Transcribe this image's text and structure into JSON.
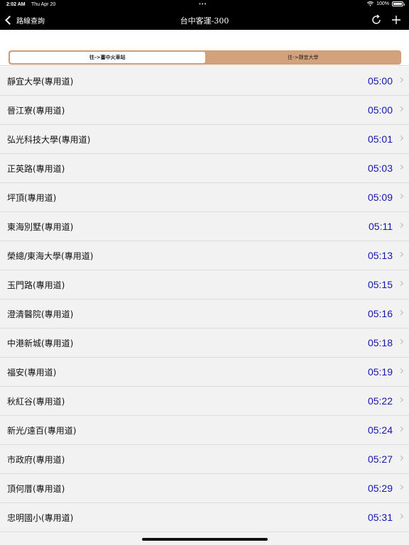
{
  "status": {
    "time": "2:02 AM",
    "date": "Thu Apr 20",
    "battery": "100%"
  },
  "nav": {
    "back_label": "路線查詢",
    "title": "台中客運-300"
  },
  "segments": [
    {
      "label": "往->臺中火車站",
      "selected": true
    },
    {
      "label": "往->靜宜大學",
      "selected": false
    }
  ],
  "colors": {
    "accent_segment": "#d3a27c",
    "time_text": "#1515b0"
  },
  "stops": [
    {
      "name": "靜宜大學(專用道)",
      "time": "05:00"
    },
    {
      "name": "晉江寮(專用道)",
      "time": "05:00"
    },
    {
      "name": "弘光科技大學(專用道)",
      "time": "05:01"
    },
    {
      "name": "正英路(專用道)",
      "time": "05:03"
    },
    {
      "name": "坪頂(專用道)",
      "time": "05:09"
    },
    {
      "name": "東海別墅(專用道)",
      "time": "05:11"
    },
    {
      "name": "榮總/東海大學(專用道)",
      "time": "05:13"
    },
    {
      "name": "玉門路(專用道)",
      "time": "05:15"
    },
    {
      "name": "澄清醫院(專用道)",
      "time": "05:16"
    },
    {
      "name": "中港新城(專用道)",
      "time": "05:18"
    },
    {
      "name": "福安(專用道)",
      "time": "05:19"
    },
    {
      "name": "秋紅谷(專用道)",
      "time": "05:22"
    },
    {
      "name": "新光/遠百(專用道)",
      "time": "05:24"
    },
    {
      "name": "市政府(專用道)",
      "time": "05:27"
    },
    {
      "name": "頂何厝(專用道)",
      "time": "05:29"
    },
    {
      "name": "忠明國小(專用道)",
      "time": "05:31"
    },
    {
      "name": "",
      "time": ""
    }
  ]
}
